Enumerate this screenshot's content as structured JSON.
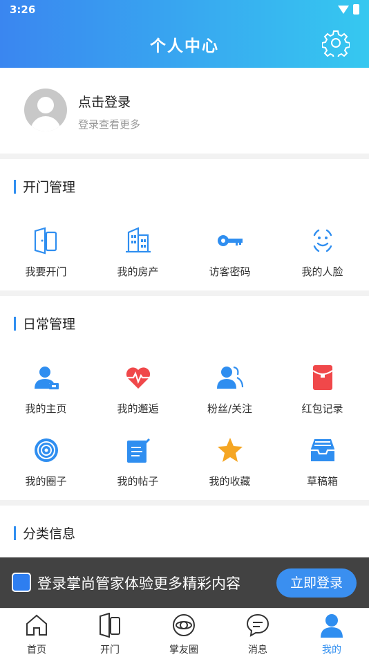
{
  "status": {
    "time": "3:26"
  },
  "header": {
    "title": "个人中心",
    "settings_icon": "gear-icon"
  },
  "profile": {
    "title": "点击登录",
    "subtitle": "登录查看更多"
  },
  "door_section": {
    "title": "开门管理",
    "items": [
      {
        "label": "我要开门",
        "icon": "door-phone-icon"
      },
      {
        "label": "我的房产",
        "icon": "building-icon"
      },
      {
        "label": "访客密码",
        "icon": "key-icon"
      },
      {
        "label": "我的人脸",
        "icon": "face-icon"
      }
    ]
  },
  "daily_section": {
    "title": "日常管理",
    "items": [
      {
        "label": "我的主页",
        "icon": "user-home-icon"
      },
      {
        "label": "我的邂逅",
        "icon": "heart-pulse-icon"
      },
      {
        "label": "粉丝/关注",
        "icon": "fans-icon"
      },
      {
        "label": "红包记录",
        "icon": "red-envelope-icon"
      },
      {
        "label": "我的圈子",
        "icon": "circle-icon"
      },
      {
        "label": "我的帖子",
        "icon": "post-icon"
      },
      {
        "label": "我的收藏",
        "icon": "star-icon"
      },
      {
        "label": "草稿箱",
        "icon": "inbox-icon"
      }
    ]
  },
  "category_section": {
    "title": "分类信息"
  },
  "banner": {
    "text": "登录掌尚管家体验更多精彩内容",
    "button": "立即登录"
  },
  "tabbar": {
    "items": [
      {
        "label": "首页",
        "icon": "home-icon"
      },
      {
        "label": "开门",
        "icon": "door-icon"
      },
      {
        "label": "掌友圈",
        "icon": "planet-icon"
      },
      {
        "label": "消息",
        "icon": "message-icon"
      },
      {
        "label": "我的",
        "icon": "user-icon",
        "active": true
      }
    ]
  },
  "colors": {
    "accent": "#2f8ef0",
    "header_start": "#3a86f0",
    "header_end": "#36c8f0",
    "red": "#f0484a",
    "star": "#f5a623"
  }
}
